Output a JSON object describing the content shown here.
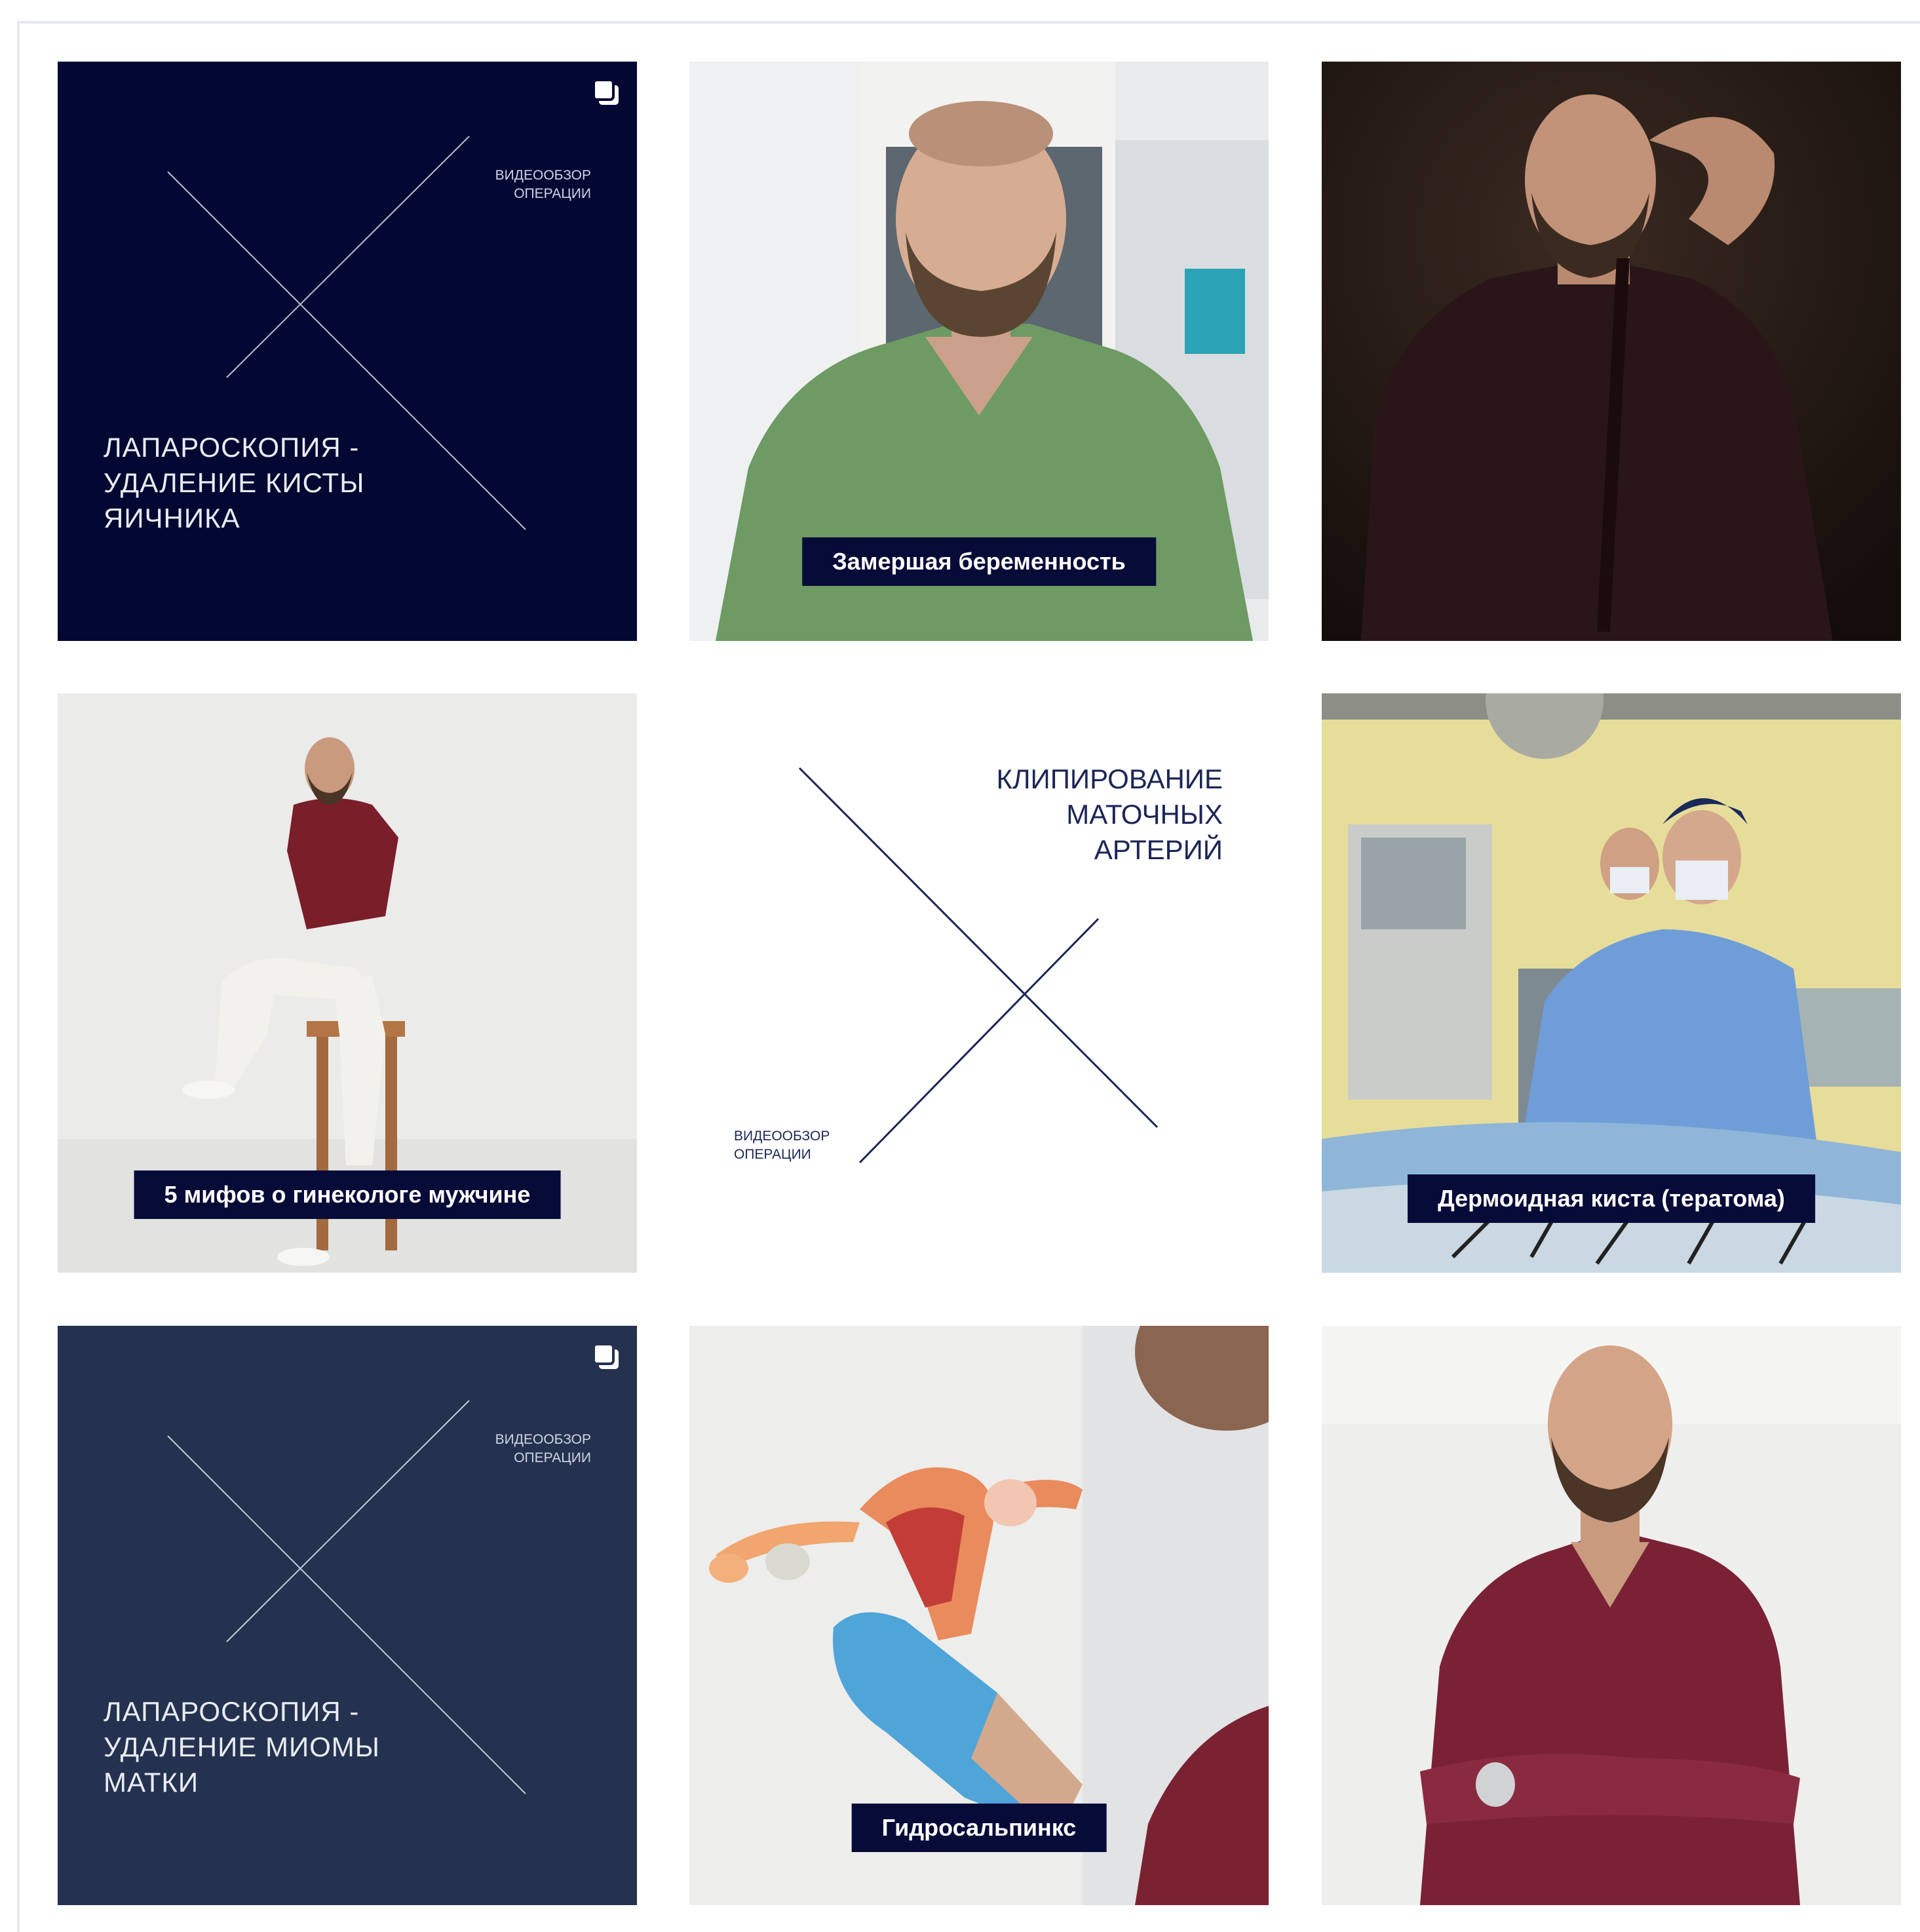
{
  "tiles": [
    {
      "kind": "video-review",
      "title": "ЛАПАРОСКОПИЯ -\nУДАЛЕНИЕ КИСТЫ\nЯИЧНИКА",
      "caption": "ВИДЕООБЗОР\nОПЕРАЦИИ",
      "bg": "#030832",
      "icon": "multiple-posts-icon"
    },
    {
      "kind": "photo",
      "label": "Замершая беременность",
      "icon": "doctor-green-scrubs-photo"
    },
    {
      "kind": "photo",
      "label": "",
      "icon": "doctor-dark-portrait-photo"
    },
    {
      "kind": "photo",
      "label": "5 мифов о гинекологе мужчине",
      "icon": "doctor-on-stool-photo"
    },
    {
      "kind": "video-review",
      "title": "КЛИПИРОВАНИЕ\nМАТОЧНЫХ\nАРТЕРИЙ",
      "caption": "ВИДЕООБЗОР\nОПЕРАЦИИ",
      "bg": "#ffffff"
    },
    {
      "kind": "photo",
      "label": "Дермоидная киста (тератома)",
      "icon": "operating-room-photo"
    },
    {
      "kind": "video-review",
      "title": "ЛАПАРОСКОПИЯ -\nУДАЛЕНИЕ МИОМЫ\nМАТКИ",
      "caption": "ВИДЕООБЗОР\nОПЕРАЦИИ",
      "bg": "#24324f",
      "icon": "multiple-posts-icon"
    },
    {
      "kind": "photo",
      "label": "Гидросальпинкс",
      "icon": "uterus-model-photo"
    },
    {
      "kind": "photo",
      "label": "",
      "icon": "doctor-burgundy-scrubs-photo"
    }
  ],
  "colors": {
    "label_bg": "#070b38",
    "navy": "#030832",
    "slate": "#24324f"
  }
}
